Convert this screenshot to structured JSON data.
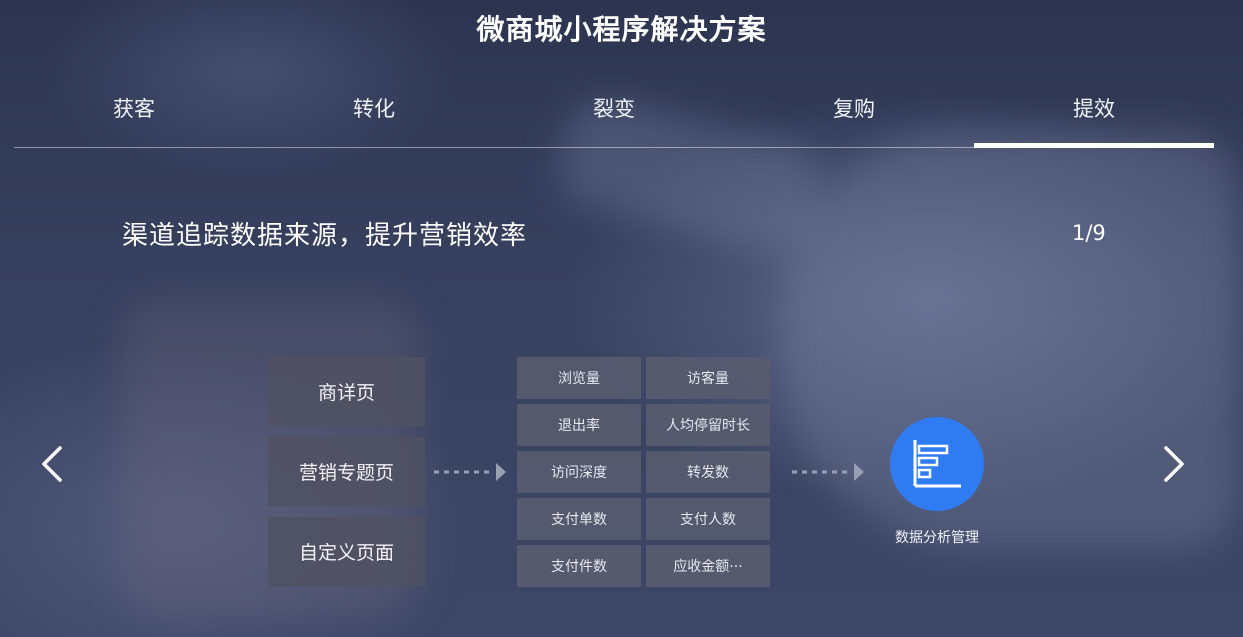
{
  "title": "微商城小程序解决方案",
  "tabs": [
    {
      "label": "获客",
      "active": false
    },
    {
      "label": "转化",
      "active": false
    },
    {
      "label": "裂变",
      "active": false
    },
    {
      "label": "复购",
      "active": false
    },
    {
      "label": "提效",
      "active": true
    }
  ],
  "slide": {
    "subtitle": "渠道追踪数据来源，提升营销效率",
    "page_indicator": "1/9"
  },
  "sources": [
    "商详页",
    "营销专题页",
    "自定义页面"
  ],
  "metrics": [
    "浏览量",
    "访客量",
    "退出率",
    "人均停留时长",
    "访问深度",
    "转发数",
    "支付单数",
    "支付人数",
    "支付件数",
    "应收金额···"
  ],
  "analysis": {
    "label": "数据分析管理",
    "icon": "bar-chart-icon",
    "color": "#2f7cf2"
  },
  "icons": {
    "prev": "chevron-left-icon",
    "next": "chevron-right-icon",
    "flow": "dashed-arrow-icon"
  }
}
